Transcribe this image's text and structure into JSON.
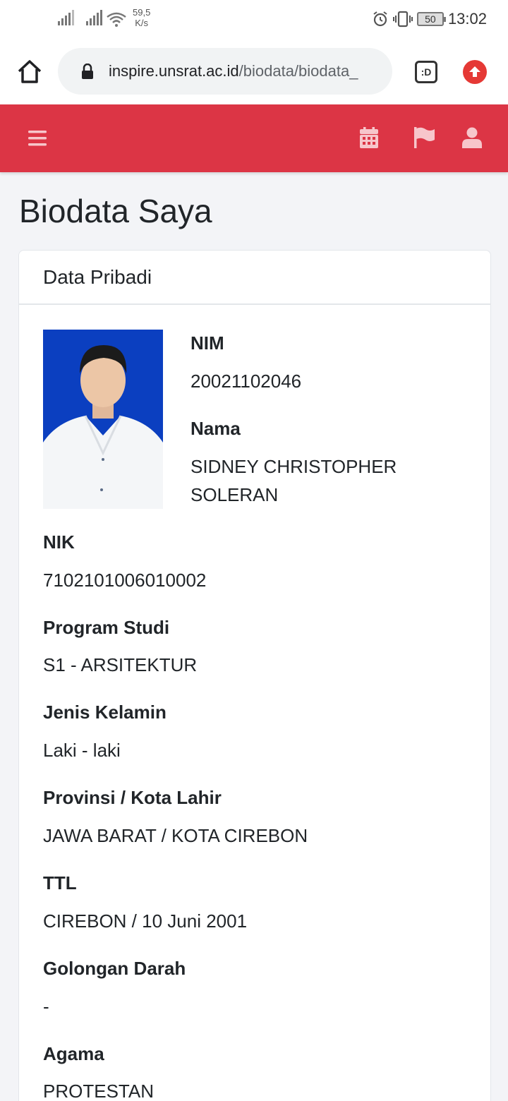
{
  "status_bar": {
    "net_speed": "59,5",
    "net_unit": "K/s",
    "battery": "50",
    "time": "13:02"
  },
  "browser": {
    "url_domain": "inspire.unsrat.ac.id",
    "url_path": "/biodata/biodata_",
    "tab_label": ":D"
  },
  "navbar": {
    "icons": [
      "menu-icon",
      "calendar-icon",
      "flag-icon",
      "user-icon"
    ]
  },
  "page": {
    "title": "Biodata Saya"
  },
  "card": {
    "header": "Data Pribadi",
    "nim_label": "NIM",
    "nim_value": "20021102046",
    "nama_label": "Nama",
    "nama_value_line1": "SIDNEY CHRISTOPHER",
    "nama_value_line2": "SOLERAN",
    "fields": [
      {
        "label": "NIK",
        "value": "7102101006010002"
      },
      {
        "label": "Program Studi",
        "value": "S1 - ARSITEKTUR"
      },
      {
        "label": "Jenis Kelamin",
        "value": "Laki - laki"
      },
      {
        "label": "Provinsi / Kota Lahir",
        "value": "JAWA BARAT / KOTA CIREBON"
      },
      {
        "label": "TTL",
        "value": "CIREBON / 10 Juni 2001"
      },
      {
        "label": "Golongan Darah",
        "value": "-"
      },
      {
        "label": "Agama",
        "value": "PROTESTAN"
      }
    ]
  },
  "colors": {
    "navbar": "#dc3545",
    "background": "#f3f4f7",
    "photo_background": "#0b3fc0"
  }
}
